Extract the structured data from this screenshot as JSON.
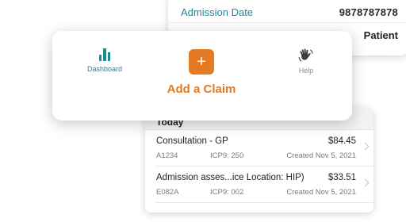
{
  "detail": {
    "label": "Admission Date",
    "value": "9878787878",
    "second_row_text": "Patient"
  },
  "menu": {
    "dashboard": {
      "label": "Dashboard",
      "icon": "bar-chart-icon"
    },
    "add_claim": {
      "label": "Add a Claim",
      "symbol": "+",
      "icon": "plus-icon"
    },
    "help": {
      "label": "Help",
      "icon": "waving-hand-icon"
    }
  },
  "claims": {
    "section_header": "Today",
    "rows": [
      {
        "title": "Consultation - GP",
        "amount": "$84.45",
        "code": "A1234",
        "icp": "ICP9: 250",
        "created": "Created Nov 5, 2021"
      },
      {
        "title": "Admission asses...ice Location: HIP)",
        "amount": "$33.51",
        "code": "E082A",
        "icp": "ICP9: 002",
        "created": "Created Nov 5, 2021"
      }
    ]
  },
  "colors": {
    "accent_teal": "#1a8a9c",
    "accent_orange": "#e57a22"
  }
}
